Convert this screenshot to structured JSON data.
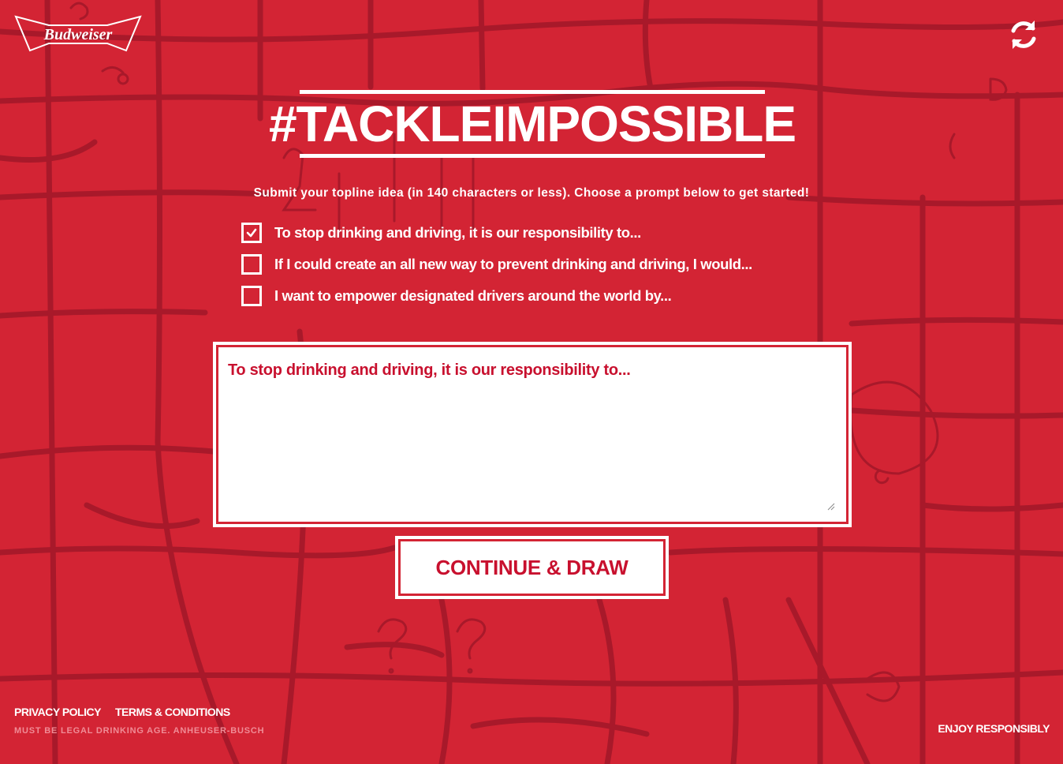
{
  "brand": {
    "logo_text": "Budweiser"
  },
  "header": {
    "refresh_icon": "refresh-icon"
  },
  "main": {
    "headline": "#TACKLEIMPOSSIBLE",
    "instruction": "Submit your topline idea (in 140 characters or less). Choose a prompt below to get started!",
    "prompts": [
      {
        "label": "To stop drinking and driving, it is our responsibility to...",
        "checked": true
      },
      {
        "label": "If I could create an all new way to prevent drinking and driving, I would...",
        "checked": false
      },
      {
        "label": "I want to empower designated drivers around the world by...",
        "checked": false
      }
    ],
    "idea_text": "To stop drinking and driving, it is our responsibility to...",
    "continue_label": "CONTINUE & DRAW"
  },
  "footer": {
    "privacy_label": "PRIVACY POLICY",
    "terms_label": "TERMS & CONDITIONS",
    "legal_text": "MUST BE LEGAL DRINKING AGE. ANHEUSER-BUSCH",
    "enjoy_label": "ENJOY RESPONSIBLY"
  },
  "colors": {
    "background": "#d32434",
    "accent": "#c8102e",
    "map_lines": "#a8192a",
    "text": "#ffffff"
  }
}
